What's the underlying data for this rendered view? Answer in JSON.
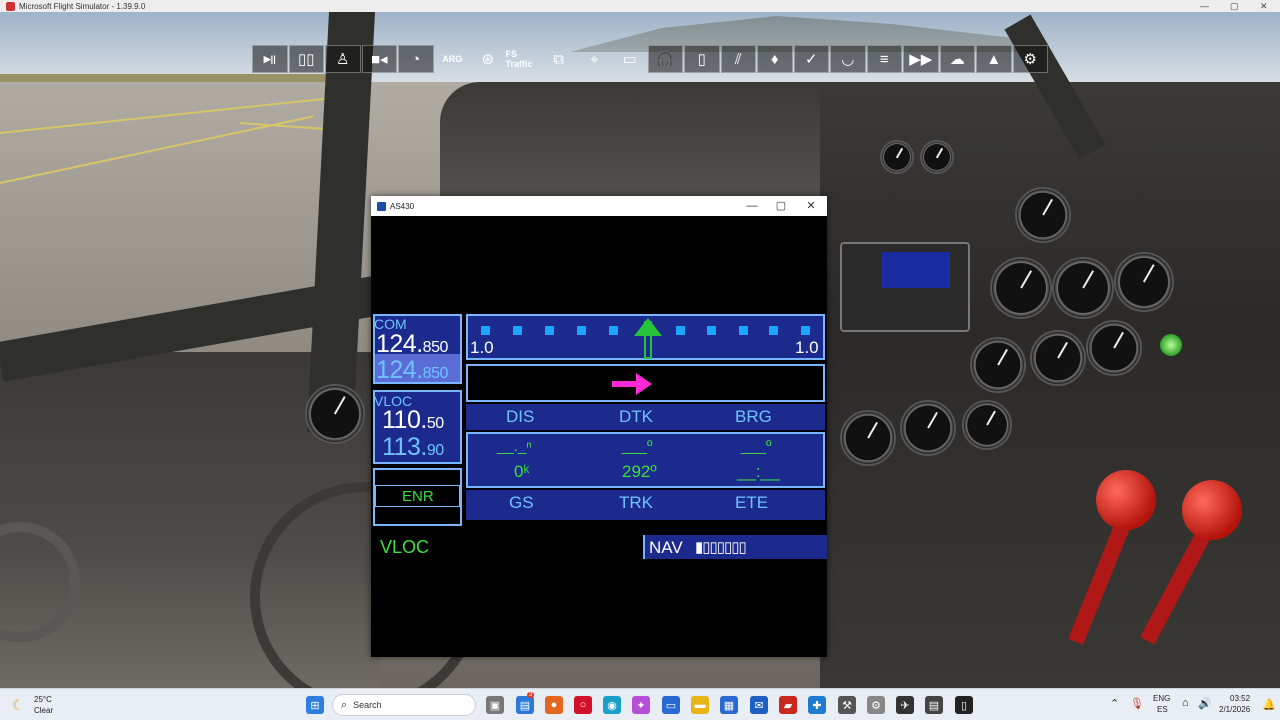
{
  "app": {
    "title": "Microsoft Flight Simulator - 1.39.9.0"
  },
  "toolbar": {
    "buttons": [
      {
        "name": "play-pause",
        "glyph": "▶||"
      },
      {
        "name": "map",
        "glyph": "▯▯"
      },
      {
        "name": "pilot",
        "glyph": "♙"
      },
      {
        "name": "camera",
        "glyph": "■◂"
      },
      {
        "name": "gauge",
        "glyph": "◔"
      },
      {
        "name": "arg",
        "glyph": "ARG"
      },
      {
        "name": "addon-1",
        "glyph": "⊛"
      },
      {
        "name": "fs-traffic",
        "glyph": "FS Traffic"
      },
      {
        "name": "addon-3",
        "glyph": "⧉"
      },
      {
        "name": "addon-4",
        "glyph": "⌖"
      },
      {
        "name": "truck",
        "glyph": "▭"
      },
      {
        "name": "headset",
        "glyph": "🎧"
      },
      {
        "name": "tablet",
        "glyph": "▯"
      },
      {
        "name": "flaps",
        "glyph": "⫽"
      },
      {
        "name": "pin",
        "glyph": "♦"
      },
      {
        "name": "checklist",
        "glyph": "✓"
      },
      {
        "name": "controls",
        "glyph": "◡"
      },
      {
        "name": "list",
        "glyph": "≡"
      },
      {
        "name": "fast-forward",
        "glyph": "▶▶"
      },
      {
        "name": "weather",
        "glyph": "☁"
      },
      {
        "name": "assistance",
        "glyph": "▲"
      },
      {
        "name": "settings",
        "glyph": "⚙"
      }
    ]
  },
  "popup": {
    "title": "AS430",
    "com": {
      "label": "COM",
      "active_main": "124.",
      "active_dec": "850",
      "standby_main": "124.",
      "standby_dec": "850"
    },
    "vloc": {
      "label": "VLOC",
      "active_main": "110.",
      "active_dec": "50",
      "standby_main": "113.",
      "standby_dec": "90"
    },
    "enr": "ENR",
    "cdi": {
      "left_scale": "1.0",
      "right_scale": "1.0"
    },
    "fields_top": {
      "dis": "DIS",
      "dtk": "DTK",
      "brg": "BRG"
    },
    "values_top": {
      "dis": "__._ⁿ",
      "dtk": "___º",
      "brg": "___º"
    },
    "values_bottom": {
      "gs": "0ᵏ",
      "trk": "292º",
      "ete": "__:__"
    },
    "fields_bottom": {
      "gs": "GS",
      "trk": "TRK",
      "ete": "ETE"
    },
    "cdi_source": "VLOC",
    "nav_label": "NAV",
    "nav_bars": "▮▯▯▯▯▯▯"
  },
  "taskbar": {
    "weather_temp": "25°C",
    "weather_desc": "Clear",
    "search_placeholder": "Search",
    "lang_top": "ENG",
    "lang_bottom": "ES",
    "time": "03:52",
    "date": "2/1/2026",
    "badge": "3"
  },
  "colors": {
    "instrument_blue": "#1c2a8e",
    "instrument_border": "#7ab6ff",
    "nav_green": "#3ce03c",
    "course_magenta": "#ff2ad4",
    "cdi_cyan": "#1ea6ff"
  }
}
